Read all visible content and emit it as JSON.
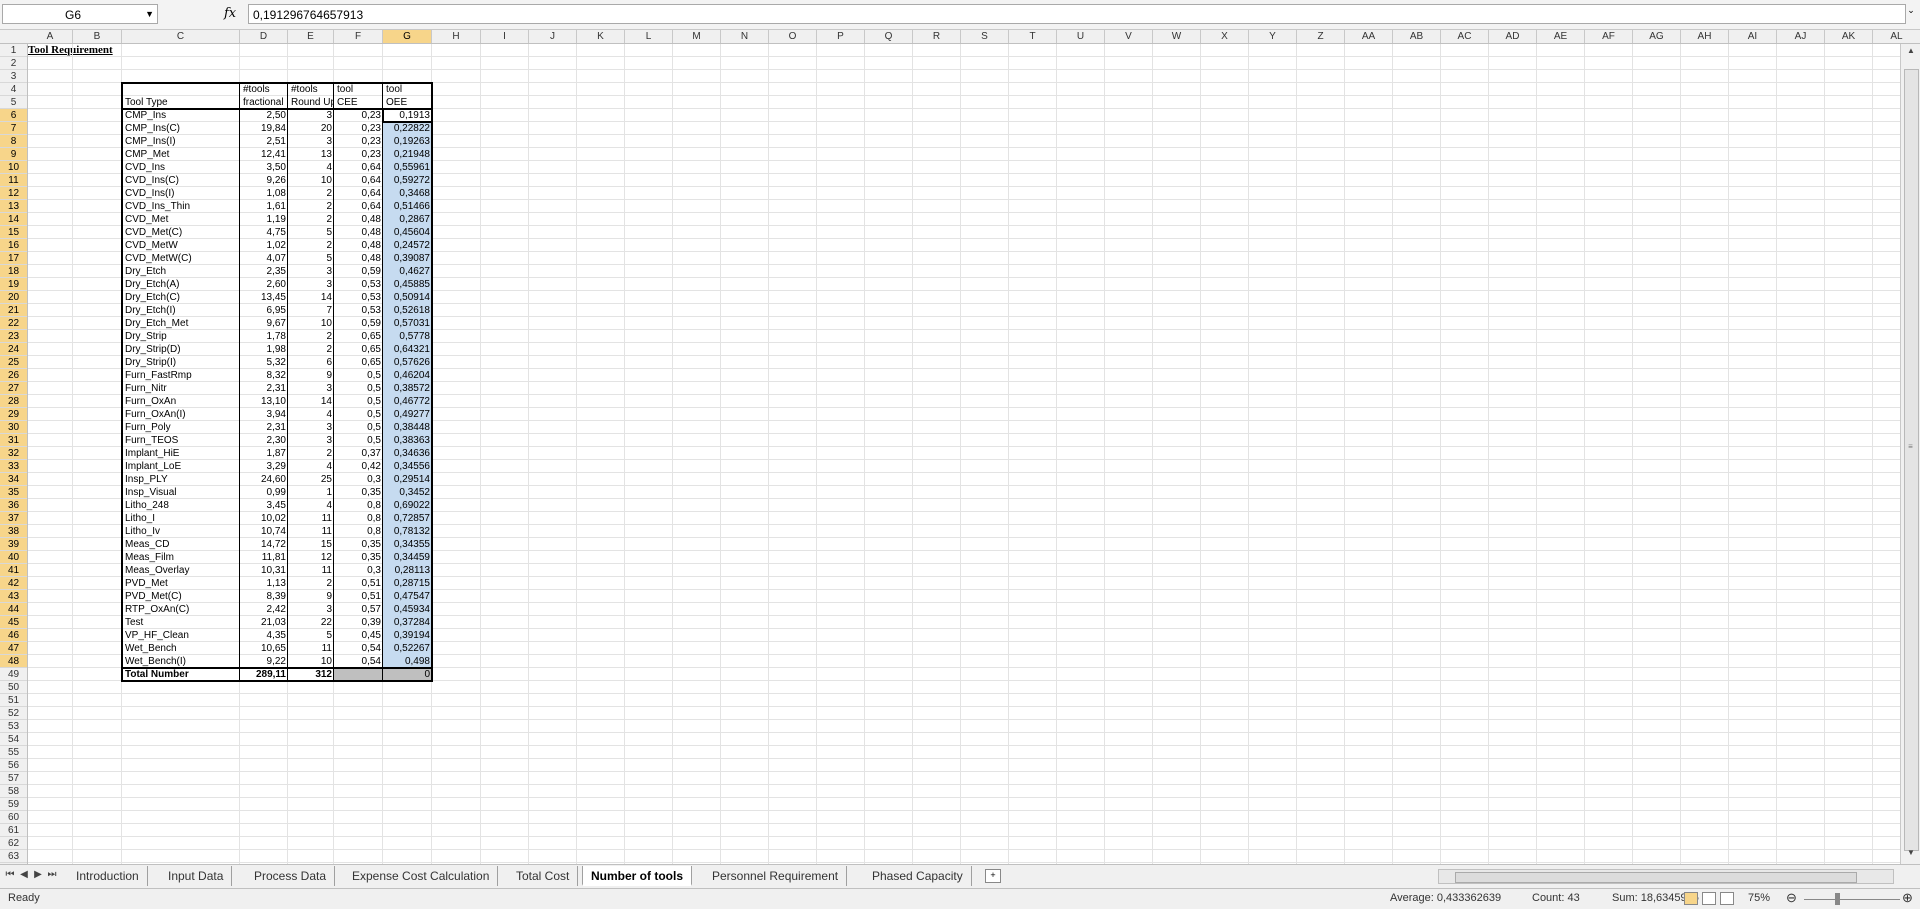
{
  "formula_bar": {
    "cell_ref": "G6",
    "fx_label": "fx",
    "formula": "0,191296764657913"
  },
  "columns": [
    "A",
    "B",
    "C",
    "D",
    "E",
    "F",
    "G",
    "H",
    "I",
    "J",
    "K",
    "L",
    "M",
    "N",
    "O",
    "P",
    "Q",
    "R",
    "S",
    "T",
    "U",
    "V",
    "W",
    "X",
    "Y",
    "Z",
    "AA",
    "AB",
    "AC",
    "AD",
    "AE",
    "AF",
    "AG",
    "AH",
    "AI",
    "AJ",
    "AK",
    "AL"
  ],
  "rows_visible_count": 63,
  "sheet": {
    "title": "Tool Requirement",
    "headers": {
      "tool_type": "Tool Type",
      "d_line1": "#tools",
      "d_line2": "fractional",
      "e_line1": "#tools",
      "e_line2": "Round Up",
      "f_line1": "tool",
      "f_line2": "CEE",
      "g_line1": "tool",
      "g_line2": "OEE"
    },
    "rows": [
      [
        "CMP_Ins",
        "2,50",
        "3",
        "0,23",
        "0,1913"
      ],
      [
        "CMP_Ins(C)",
        "19,84",
        "20",
        "0,23",
        "0,22822"
      ],
      [
        "CMP_Ins(I)",
        "2,51",
        "3",
        "0,23",
        "0,19263"
      ],
      [
        "CMP_Met",
        "12,41",
        "13",
        "0,23",
        "0,21948"
      ],
      [
        "CVD_Ins",
        "3,50",
        "4",
        "0,64",
        "0,55961"
      ],
      [
        "CVD_Ins(C)",
        "9,26",
        "10",
        "0,64",
        "0,59272"
      ],
      [
        "CVD_Ins(I)",
        "1,08",
        "2",
        "0,64",
        "0,3468"
      ],
      [
        "CVD_Ins_Thin",
        "1,61",
        "2",
        "0,64",
        "0,51466"
      ],
      [
        "CVD_Met",
        "1,19",
        "2",
        "0,48",
        "0,2867"
      ],
      [
        "CVD_Met(C)",
        "4,75",
        "5",
        "0,48",
        "0,45604"
      ],
      [
        "CVD_MetW",
        "1,02",
        "2",
        "0,48",
        "0,24572"
      ],
      [
        "CVD_MetW(C)",
        "4,07",
        "5",
        "0,48",
        "0,39087"
      ],
      [
        "Dry_Etch",
        "2,35",
        "3",
        "0,59",
        "0,4627"
      ],
      [
        "Dry_Etch(A)",
        "2,60",
        "3",
        "0,53",
        "0,45885"
      ],
      [
        "Dry_Etch(C)",
        "13,45",
        "14",
        "0,53",
        "0,50914"
      ],
      [
        "Dry_Etch(I)",
        "6,95",
        "7",
        "0,53",
        "0,52618"
      ],
      [
        "Dry_Etch_Met",
        "9,67",
        "10",
        "0,59",
        "0,57031"
      ],
      [
        "Dry_Strip",
        "1,78",
        "2",
        "0,65",
        "0,5778"
      ],
      [
        "Dry_Strip(D)",
        "1,98",
        "2",
        "0,65",
        "0,64321"
      ],
      [
        "Dry_Strip(I)",
        "5,32",
        "6",
        "0,65",
        "0,57626"
      ],
      [
        "Furn_FastRmp",
        "8,32",
        "9",
        "0,5",
        "0,46204"
      ],
      [
        "Furn_Nitr",
        "2,31",
        "3",
        "0,5",
        "0,38572"
      ],
      [
        "Furn_OxAn",
        "13,10",
        "14",
        "0,5",
        "0,46772"
      ],
      [
        "Furn_OxAn(I)",
        "3,94",
        "4",
        "0,5",
        "0,49277"
      ],
      [
        "Furn_Poly",
        "2,31",
        "3",
        "0,5",
        "0,38448"
      ],
      [
        "Furn_TEOS",
        "2,30",
        "3",
        "0,5",
        "0,38363"
      ],
      [
        "Implant_HiE",
        "1,87",
        "2",
        "0,37",
        "0,34636"
      ],
      [
        "Implant_LoE",
        "3,29",
        "4",
        "0,42",
        "0,34556"
      ],
      [
        "Insp_PLY",
        "24,60",
        "25",
        "0,3",
        "0,29514"
      ],
      [
        "Insp_Visual",
        "0,99",
        "1",
        "0,35",
        "0,3452"
      ],
      [
        "Litho_248",
        "3,45",
        "4",
        "0,8",
        "0,69022"
      ],
      [
        "Litho_I",
        "10,02",
        "11",
        "0,8",
        "0,72857"
      ],
      [
        "Litho_Iv",
        "10,74",
        "11",
        "0,8",
        "0,78132"
      ],
      [
        "Meas_CD",
        "14,72",
        "15",
        "0,35",
        "0,34355"
      ],
      [
        "Meas_Film",
        "11,81",
        "12",
        "0,35",
        "0,34459"
      ],
      [
        "Meas_Overlay",
        "10,31",
        "11",
        "0,3",
        "0,28113"
      ],
      [
        "PVD_Met",
        "1,13",
        "2",
        "0,51",
        "0,28715"
      ],
      [
        "PVD_Met(C)",
        "8,39",
        "9",
        "0,51",
        "0,47547"
      ],
      [
        "RTP_OxAn(C)",
        "2,42",
        "3",
        "0,57",
        "0,45934"
      ],
      [
        "Test",
        "21,03",
        "22",
        "0,39",
        "0,37284"
      ],
      [
        "VP_HF_Clean",
        "4,35",
        "5",
        "0,45",
        "0,39194"
      ],
      [
        "Wet_Bench",
        "10,65",
        "11",
        "0,54",
        "0,52267"
      ],
      [
        "Wet_Bench(I)",
        "9,22",
        "10",
        "0,54",
        "0,498"
      ]
    ],
    "total": {
      "label": "Total Number",
      "d": "289,11",
      "e": "312",
      "g": "0"
    }
  },
  "tabs": [
    "Introduction",
    "Input Data",
    "Process Data",
    "Expense Cost Calculation",
    "Total Cost",
    "Number of tools",
    "Personnel Requirement",
    "Phased Capacity"
  ],
  "active_tab": "Number of tools",
  "status": {
    "ready": "Ready",
    "average": "Average: 0,433362639",
    "count": "Count: 43",
    "sum": "Sum: 18,6345935",
    "zoom": "75%"
  }
}
